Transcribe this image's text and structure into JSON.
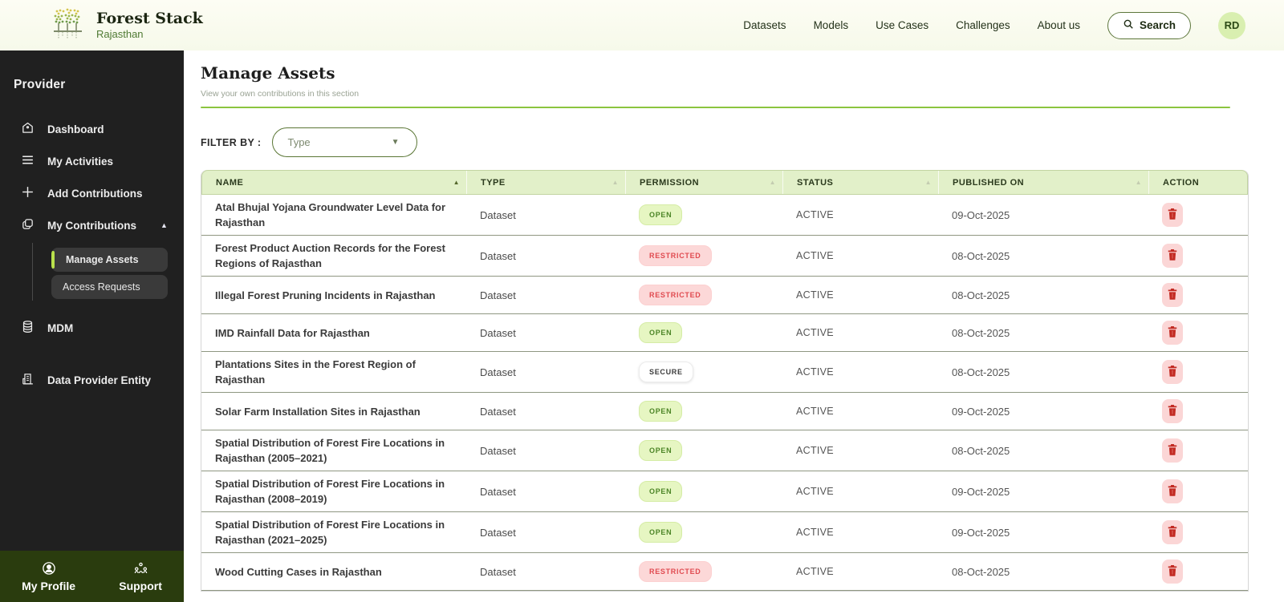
{
  "brand": {
    "title": "Forest Stack",
    "subtitle": "Rajasthan"
  },
  "topnav": {
    "items": [
      "Datasets",
      "Models",
      "Use Cases",
      "Challenges",
      "About us"
    ],
    "search_label": "Search",
    "avatar_initials": "RD"
  },
  "sidebar": {
    "heading": "Provider",
    "items": [
      {
        "label": "Dashboard",
        "icon": "home-icon"
      },
      {
        "label": "My Activities",
        "icon": "list-icon"
      },
      {
        "label": "Add Contributions",
        "icon": "plus-icon"
      },
      {
        "label": "My Contributions",
        "icon": "stack-icon",
        "expanded": true,
        "children": [
          {
            "label": "Manage Assets",
            "active": true
          },
          {
            "label": "Access Requests",
            "active": false
          }
        ]
      },
      {
        "label": "MDM",
        "icon": "database-icon"
      },
      {
        "label": "Data Provider Entity",
        "icon": "building-icon"
      }
    ],
    "footer": [
      {
        "label": "My Profile",
        "icon": "profile-icon"
      },
      {
        "label": "Support",
        "icon": "support-icon"
      }
    ]
  },
  "page": {
    "title": "Manage Assets",
    "subtitle": "View your own contributions in this section",
    "filter_label": "FILTER BY :",
    "filter_value": "Type"
  },
  "table": {
    "columns": [
      "NAME",
      "TYPE",
      "PERMISSION",
      "STATUS",
      "PUBLISHED ON",
      "ACTION"
    ],
    "sorted_column": "NAME",
    "rows": [
      {
        "name": "Atal Bhujal Yojana Groundwater Level Data for Rajasthan",
        "type": "Dataset",
        "permission": "OPEN",
        "status": "ACTIVE",
        "published": "09-Oct-2025"
      },
      {
        "name": "Forest Product Auction Records for the Forest Regions of Rajasthan",
        "type": "Dataset",
        "permission": "RESTRICTED",
        "status": "ACTIVE",
        "published": "08-Oct-2025"
      },
      {
        "name": "Illegal Forest Pruning Incidents in Rajasthan",
        "type": "Dataset",
        "permission": "RESTRICTED",
        "status": "ACTIVE",
        "published": "08-Oct-2025"
      },
      {
        "name": "IMD Rainfall Data for Rajasthan",
        "type": "Dataset",
        "permission": "OPEN",
        "status": "ACTIVE",
        "published": "08-Oct-2025"
      },
      {
        "name": "Plantations Sites in the Forest Region of Rajasthan",
        "type": "Dataset",
        "permission": "SECURE",
        "status": "ACTIVE",
        "published": "08-Oct-2025"
      },
      {
        "name": "Solar Farm Installation Sites in Rajasthan",
        "type": "Dataset",
        "permission": "OPEN",
        "status": "ACTIVE",
        "published": "09-Oct-2025"
      },
      {
        "name": "Spatial Distribution of Forest Fire Locations in Rajasthan (2005–2021)",
        "type": "Dataset",
        "permission": "OPEN",
        "status": "ACTIVE",
        "published": "08-Oct-2025"
      },
      {
        "name": "Spatial Distribution of Forest Fire Locations in Rajasthan (2008–2019)",
        "type": "Dataset",
        "permission": "OPEN",
        "status": "ACTIVE",
        "published": "09-Oct-2025"
      },
      {
        "name": "Spatial Distribution of Forest Fire Locations in Rajasthan (2021–2025)",
        "type": "Dataset",
        "permission": "OPEN",
        "status": "ACTIVE",
        "published": "09-Oct-2025"
      },
      {
        "name": "Wood Cutting Cases in Rajasthan",
        "type": "Dataset",
        "permission": "RESTRICTED",
        "status": "ACTIVE",
        "published": "08-Oct-2025"
      }
    ]
  },
  "colors": {
    "accent_green": "#8bc53f",
    "sidebar_bg": "#202020",
    "sidebar_footer_bg": "#2a3c0e",
    "table_header_bg": "#e2f0c9",
    "badge_open_bg": "#e6f6c2",
    "badge_open_text": "#4c8527",
    "badge_restricted_bg": "#fcd8d8",
    "badge_restricted_text": "#e04a50",
    "badge_secure_bg": "#ffffff",
    "badge_secure_text": "#3c3c3c",
    "delete_btn_bg": "#fbd6d6",
    "delete_icon": "#c22a22",
    "avatar_bg": "#d9efb0"
  }
}
